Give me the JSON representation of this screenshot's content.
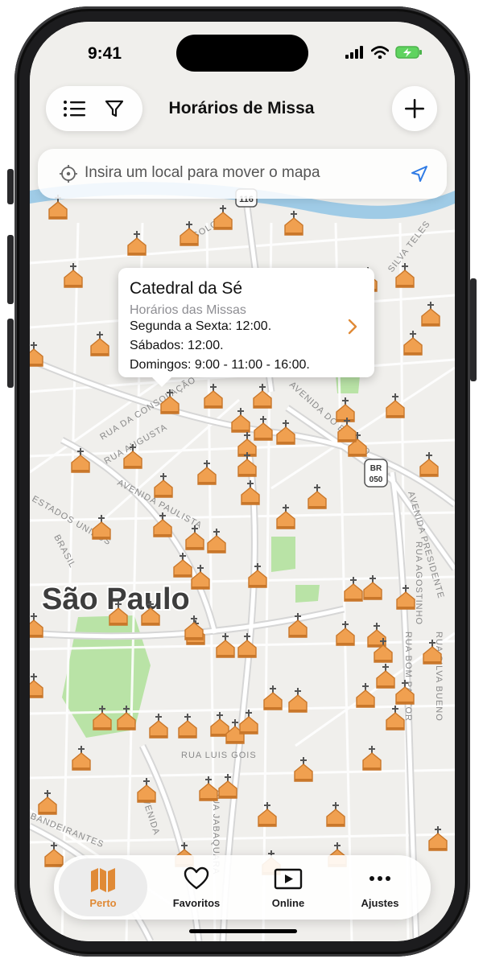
{
  "status_bar": {
    "time": "9:41"
  },
  "header": {
    "title": "Horários de Missa"
  },
  "search": {
    "placeholder": "Insira um local para mover o mapa"
  },
  "callout": {
    "name": "Catedral da Sé",
    "subtitle": "Horários das Missas",
    "lines": [
      "Segunda a Sexta: 12:00.",
      "Sábados: 12:00.",
      "Domingos: 9:00 - 11:00 - 16:00."
    ]
  },
  "map": {
    "city_label": "São Paulo",
    "streets": [
      "RUA DA CONSOLAÇÃO",
      "RUA AUGUSTA",
      "AVENIDA PAULISTA",
      "ESTADOS UNIDOS",
      "AVENIDA DO ESTADO",
      "AVENIDA PRESIDENTE",
      "RUA AGOSTINHO",
      "RUA BOM PASTOR",
      "RUA SILVA BUENO",
      "RUA LUIS GOIS",
      "RUA JABAQUARA",
      "AVENIDA",
      "BANDEIRANTES",
      "BRASIL",
      "SILVA TELES",
      "SOLON"
    ],
    "highway_badges": [
      "116",
      "050"
    ],
    "highway_label": "BR"
  },
  "tabs": [
    {
      "label": "Perto",
      "icon": "map-icon",
      "active": true
    },
    {
      "label": "Favoritos",
      "icon": "heart-icon",
      "active": false
    },
    {
      "label": "Online",
      "icon": "play-icon",
      "active": false
    },
    {
      "label": "Ajustes",
      "icon": "ellipsis-icon",
      "active": false
    }
  ],
  "colors": {
    "accent": "#e08a36",
    "pin": "#f0a050",
    "pin_dark": "#c9772a",
    "park": "#b9e3a6",
    "water": "#9fcbe6"
  }
}
